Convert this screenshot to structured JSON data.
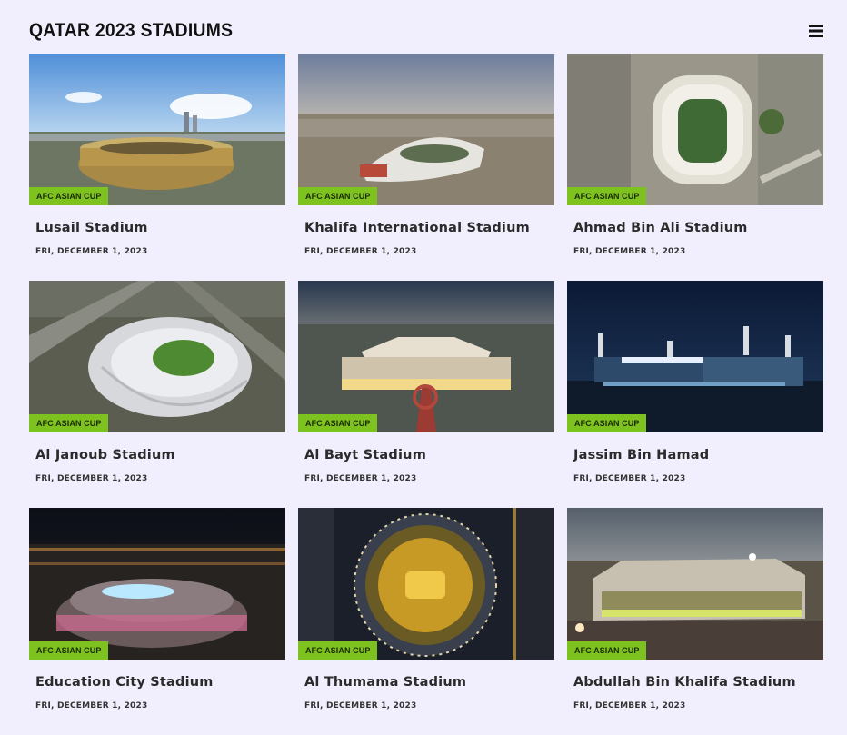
{
  "header": {
    "title": "QATAR 2023 STADIUMS",
    "icon": "list-view-icon"
  },
  "accent_color": "#7dc21e",
  "cards": [
    {
      "name": "Lusail Stadium",
      "category": "AFC ASIAN CUP",
      "date": "FRI, DECEMBER 1, 2023"
    },
    {
      "name": "Khalifa International Stadium",
      "category": "AFC ASIAN CUP",
      "date": "FRI, DECEMBER 1, 2023"
    },
    {
      "name": "Ahmad Bin Ali Stadium",
      "category": "AFC ASIAN CUP",
      "date": "FRI, DECEMBER 1, 2023"
    },
    {
      "name": "Al Janoub Stadium",
      "category": "AFC ASIAN CUP",
      "date": "FRI, DECEMBER 1, 2023"
    },
    {
      "name": "Al Bayt Stadium",
      "category": "AFC ASIAN CUP",
      "date": "FRI, DECEMBER 1, 2023"
    },
    {
      "name": "Jassim Bin Hamad",
      "category": "AFC ASIAN CUP",
      "date": "FRI, DECEMBER 1, 2023"
    },
    {
      "name": "Education City Stadium",
      "category": "AFC ASIAN CUP",
      "date": "FRI, DECEMBER 1, 2023"
    },
    {
      "name": "Al Thumama Stadium",
      "category": "AFC ASIAN CUP",
      "date": "FRI, DECEMBER 1, 2023"
    },
    {
      "name": "Abdullah Bin Khalifa Stadium",
      "category": "AFC ASIAN CUP",
      "date": "FRI, DECEMBER 1, 2023"
    }
  ]
}
